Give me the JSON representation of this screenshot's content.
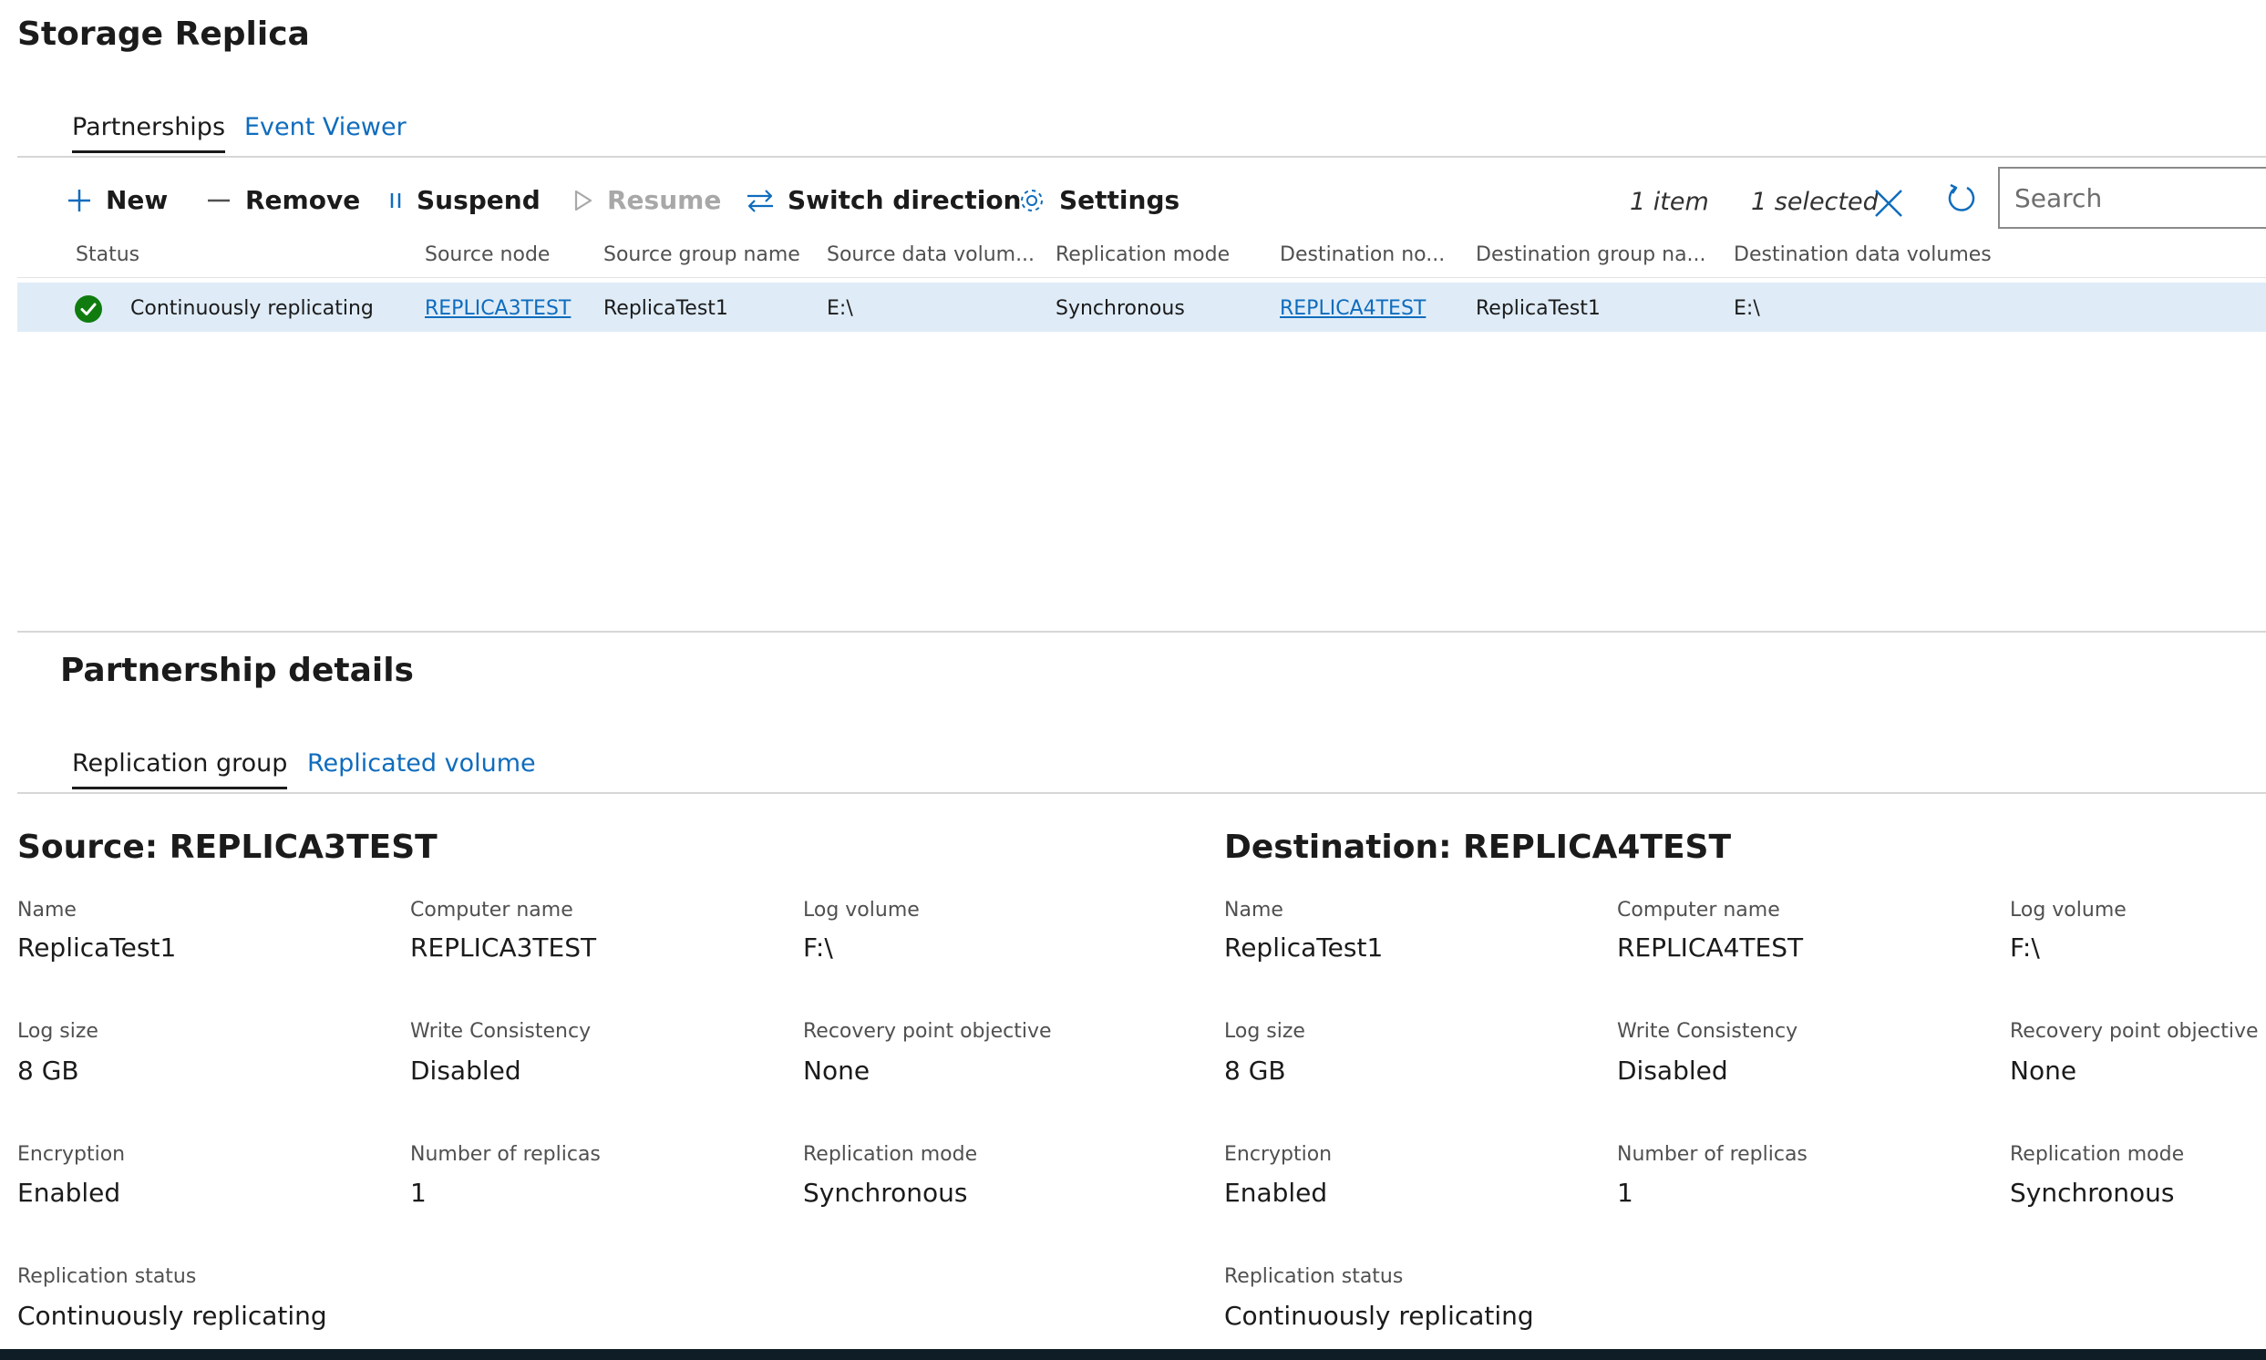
{
  "page": {
    "title": "Storage Replica"
  },
  "tabs": [
    {
      "label": "Partnerships",
      "active": true
    },
    {
      "label": "Event Viewer",
      "active": false
    }
  ],
  "toolbar": {
    "new_label": "New",
    "remove_label": "Remove",
    "suspend_label": "Suspend",
    "resume_label": "Resume",
    "switch_label": "Switch direction",
    "settings_label": "Settings",
    "item_count": "1 item",
    "selected_count": "1 selected",
    "search_placeholder": "Search"
  },
  "table": {
    "columns": [
      "Status",
      "Source node",
      "Source group name",
      "Source data volum...",
      "Replication mode",
      "Destination no...",
      "Destination group na...",
      "Destination data volumes"
    ],
    "rows": [
      {
        "status": "Continuously replicating",
        "source_node": "REPLICA3TEST",
        "source_group": "ReplicaTest1",
        "source_volumes": "E:\\",
        "replication_mode": "Synchronous",
        "destination_node": "REPLICA4TEST",
        "destination_group": "ReplicaTest1",
        "destination_volumes": "E:\\"
      }
    ]
  },
  "details": {
    "title": "Partnership details",
    "tabs": [
      {
        "label": "Replication group",
        "active": true
      },
      {
        "label": "Replicated volume",
        "active": false
      }
    ],
    "source": {
      "title": "Source: REPLICA3TEST",
      "fields": [
        {
          "label": "Name",
          "value": "ReplicaTest1"
        },
        {
          "label": "Computer name",
          "value": "REPLICA3TEST"
        },
        {
          "label": "Log volume",
          "value": "F:\\"
        },
        {
          "label": "Log size",
          "value": "8 GB"
        },
        {
          "label": "Write Consistency",
          "value": "Disabled"
        },
        {
          "label": "Recovery point objective",
          "value": "None"
        },
        {
          "label": "Encryption",
          "value": "Enabled"
        },
        {
          "label": "Number of replicas",
          "value": "1"
        },
        {
          "label": "Replication mode",
          "value": "Synchronous"
        },
        {
          "label": "Replication status",
          "value": "Continuously replicating"
        }
      ]
    },
    "destination": {
      "title": "Destination: REPLICA4TEST",
      "fields": [
        {
          "label": "Name",
          "value": "ReplicaTest1"
        },
        {
          "label": "Computer name",
          "value": "REPLICA4TEST"
        },
        {
          "label": "Log volume",
          "value": "F:\\"
        },
        {
          "label": "Log size",
          "value": "8 GB"
        },
        {
          "label": "Write Consistency",
          "value": "Disabled"
        },
        {
          "label": "Recovery point objective",
          "value": "None"
        },
        {
          "label": "Encryption",
          "value": "Enabled"
        },
        {
          "label": "Number of replicas",
          "value": "1"
        },
        {
          "label": "Replication mode",
          "value": "Synchronous"
        },
        {
          "label": "Replication status",
          "value": "Continuously replicating"
        }
      ]
    }
  },
  "icons": {
    "new": "plus-icon",
    "remove": "minus-icon",
    "suspend": "pause-icon",
    "resume": "play-icon",
    "switch": "swap-arrows-icon",
    "settings": "gear-icon",
    "clear_selection": "close-icon",
    "refresh": "refresh-icon",
    "status": "check-circle-icon"
  },
  "colors": {
    "accent": "#0f6cbd",
    "selected_row": "#dfecf8",
    "success": "#107c10",
    "disabled": "#a8a8a8"
  }
}
